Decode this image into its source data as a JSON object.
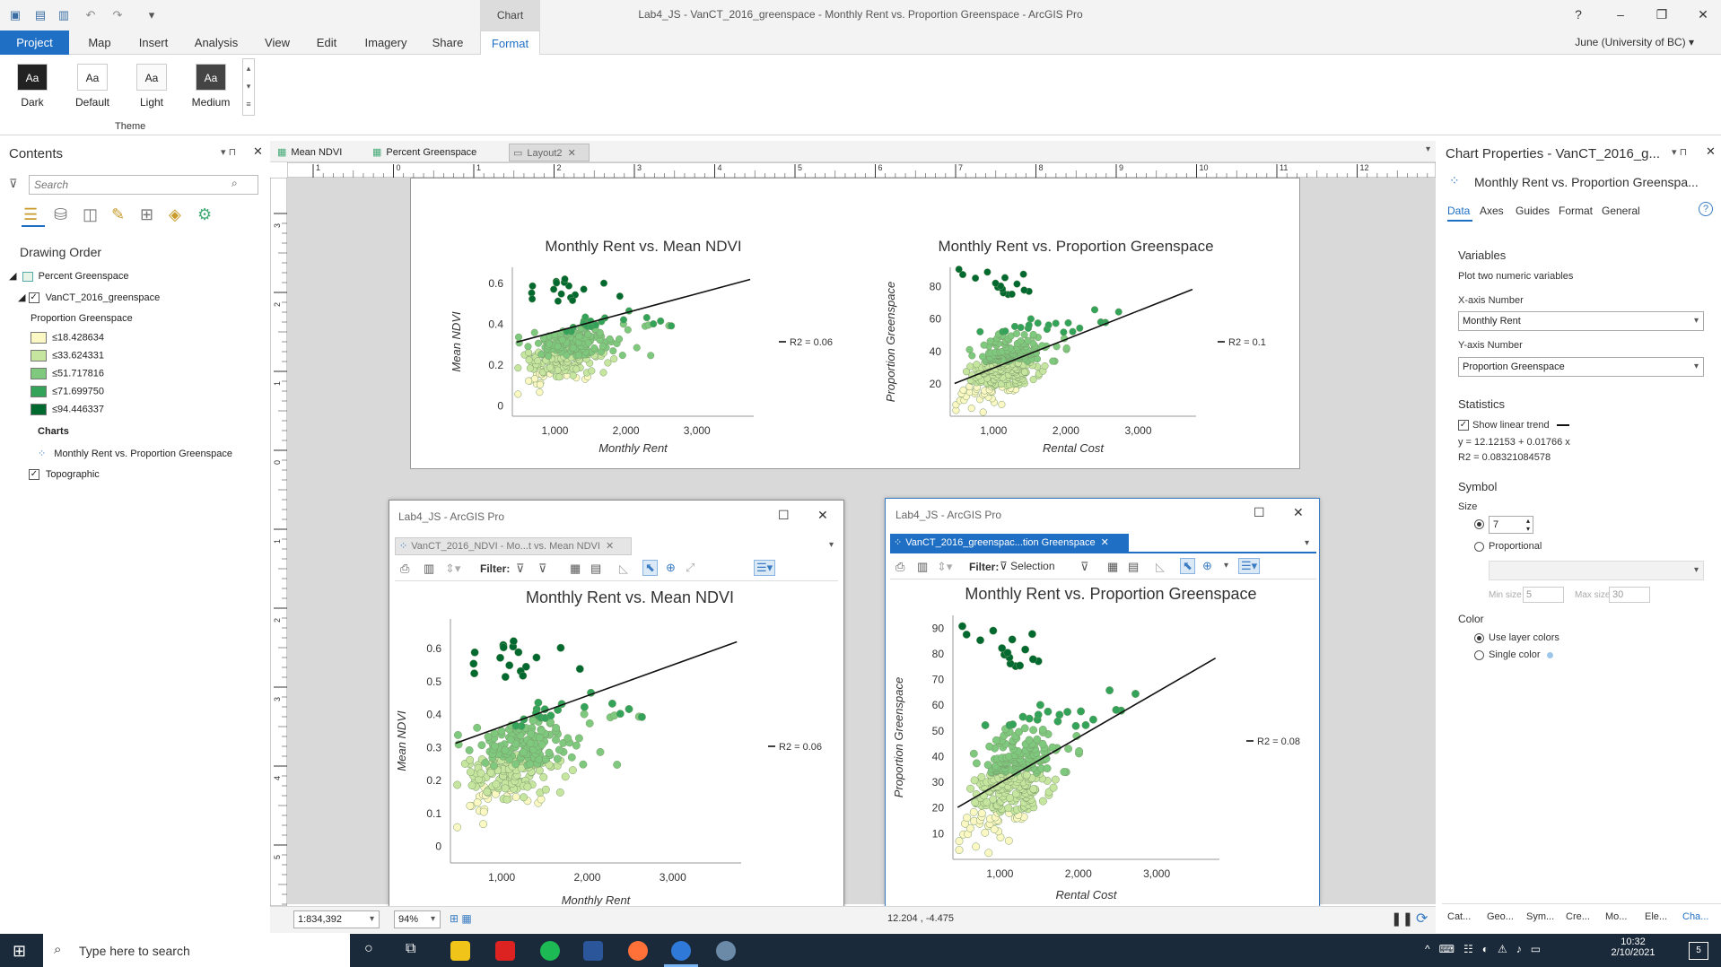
{
  "window": {
    "title": "Lab4_JS - VanCT_2016_greenspace - Monthly Rent vs. Proportion Greenspace - ArcGIS Pro",
    "context_tab": "Chart",
    "help": "?"
  },
  "ribbon": {
    "tabs": [
      "Project",
      "Map",
      "Insert",
      "Analysis",
      "View",
      "Edit",
      "Imagery",
      "Share",
      "Format"
    ],
    "active_tab": "Format",
    "user": "June (University of BC) ▾",
    "theme_group": "Theme",
    "themes": [
      {
        "label": "Dark",
        "glyph": "Aa"
      },
      {
        "label": "Default",
        "glyph": "Aa"
      },
      {
        "label": "Light",
        "glyph": "Aa"
      },
      {
        "label": "Medium",
        "glyph": "Aa"
      }
    ]
  },
  "contents": {
    "title": "Contents",
    "search_placeholder": "Search",
    "drawing_order": "Drawing Order",
    "layers": [
      {
        "name": "Percent Greenspace"
      },
      {
        "name": "VanCT_2016_greenspace",
        "checked": true
      },
      {
        "name": "Topographic",
        "checked": true
      }
    ],
    "legend_title": "Proportion Greenspace",
    "legend": [
      {
        "label": "≤18.428634",
        "color": "#fbf8c4"
      },
      {
        "label": "≤33.624331",
        "color": "#c6e6a0"
      },
      {
        "label": "≤51.717816",
        "color": "#7fc97f"
      },
      {
        "label": "≤71.699750",
        "color": "#33a35a"
      },
      {
        "label": "≤94.446337",
        "color": "#00692f"
      }
    ],
    "charts_label": "Charts",
    "chart_item": "Monthly Rent vs. Proportion Greenspace"
  },
  "view_tabs": [
    {
      "label": "Mean NDVI",
      "active": false
    },
    {
      "label": "Percent Greenspace",
      "active": false
    },
    {
      "label": "Layout2",
      "active": true
    }
  ],
  "ruler_labels": [
    "1",
    "0",
    "1",
    "2",
    "3",
    "4",
    "5",
    "6",
    "7",
    "8",
    "9",
    "10",
    "11",
    "12"
  ],
  "left_ruler_labels": [
    "3",
    "2",
    "1",
    "0",
    "1",
    "2",
    "3",
    "4",
    "5"
  ],
  "windows": [
    {
      "title": "Lab4_JS - ArcGIS Pro",
      "tab": "VanCT_2016_NDVI - Mo...t vs. Mean NDVI",
      "filter": "Filter:"
    },
    {
      "title": "Lab4_JS - ArcGIS Pro",
      "tab": "VanCT_2016_greenspac...tion Greenspace",
      "filter": "Filter:",
      "selection": "Selection"
    }
  ],
  "chart_data": [
    {
      "type": "scatter",
      "title": "Monthly Rent vs. Mean NDVI",
      "xlabel": "Monthly Rent",
      "ylabel": "Mean NDVI",
      "xlim": [
        400,
        3800
      ],
      "ylim": [
        -0.05,
        0.68
      ],
      "xticks": [
        "1,000",
        "2,000",
        "3,000"
      ],
      "xtick_values": [
        1000,
        2000,
        3000
      ],
      "yticks": [
        "0",
        "0.2",
        "0.4",
        "0.6"
      ],
      "ytick_values": [
        0,
        0.2,
        0.4,
        0.6
      ],
      "legend": "R2 = 0.06",
      "trend": {
        "intercept": 0.27,
        "slope": 9.35e-05
      },
      "seed": 3,
      "ymode": "ndvi"
    },
    {
      "type": "scatter",
      "title": "Monthly Rent vs. Proportion Greenspace",
      "xlabel": "Rental Cost",
      "ylabel": "Proportion Greenspace",
      "xlim": [
        400,
        3800
      ],
      "ylim": [
        0,
        92
      ],
      "xticks": [
        "1,000",
        "2,000",
        "3,000"
      ],
      "xtick_values": [
        1000,
        2000,
        3000
      ],
      "yticks": [
        "20",
        "40",
        "60",
        "80"
      ],
      "ytick_values": [
        20,
        40,
        60,
        80
      ],
      "legend": "R2 = 0.1",
      "trend": {
        "intercept": 12.12,
        "slope": 0.01766
      },
      "seed": 7,
      "ymode": "green"
    },
    {
      "type": "scatter",
      "title": "Monthly Rent vs. Mean NDVI",
      "xlabel": "Monthly Rent",
      "ylabel": "Mean NDVI",
      "xlim": [
        400,
        3800
      ],
      "ylim": [
        -0.05,
        0.69
      ],
      "xticks": [
        "1,000",
        "2,000",
        "3,000"
      ],
      "xtick_values": [
        1000,
        2000,
        3000
      ],
      "yticks": [
        "0",
        "0.1",
        "0.2",
        "0.3",
        "0.4",
        "0.5",
        "0.6"
      ],
      "ytick_values": [
        0,
        0.1,
        0.2,
        0.3,
        0.4,
        0.5,
        0.6
      ],
      "legend": "R2 = 0.06",
      "trend": {
        "intercept": 0.27,
        "slope": 9.35e-05
      },
      "seed": 3,
      "ymode": "ndvi"
    },
    {
      "type": "scatter",
      "title": "Monthly Rent vs. Proportion Greenspace",
      "xlabel": "Rental Cost",
      "ylabel": "Proportion Greenspace",
      "xlim": [
        400,
        3800
      ],
      "ylim": [
        0,
        95
      ],
      "xticks": [
        "1,000",
        "2,000",
        "3,000"
      ],
      "xtick_values": [
        1000,
        2000,
        3000
      ],
      "yticks": [
        "10",
        "20",
        "30",
        "40",
        "50",
        "60",
        "70",
        "80",
        "90"
      ],
      "ytick_values": [
        10,
        20,
        30,
        40,
        50,
        60,
        70,
        80,
        90
      ],
      "legend": "R2 = 0.08",
      "trend": {
        "intercept": 12.12,
        "slope": 0.01766
      },
      "seed": 7,
      "ymode": "green"
    }
  ],
  "chart_properties": {
    "title": "Chart Properties - VanCT_2016_g...",
    "chart_name": "Monthly Rent vs. Proportion Greenspa...",
    "tabs": [
      "Data",
      "Axes",
      "Guides",
      "Format",
      "General"
    ],
    "variables_header": "Variables",
    "variables_desc": "Plot two numeric variables",
    "x_label": "X-axis Number",
    "x_value": "Monthly Rent",
    "y_label": "Y-axis Number",
    "y_value": "Proportion Greenspace",
    "statistics_header": "Statistics",
    "show_trend": "Show linear trend",
    "equation": "y = 12.12153 + 0.01766 x",
    "r2": "R2 = 0.08321084578",
    "symbol_header": "Symbol",
    "size_label": "Size",
    "size_value": "7",
    "proportional": "Proportional",
    "min_size_label": "Min size",
    "min_size": "5",
    "max_size_label": "Max size",
    "max_size": "30",
    "color_header": "Color",
    "use_layer_colors": "Use layer colors",
    "single_color": "Single color",
    "bottom_tabs": [
      "Cat...",
      "Geo...",
      "Sym...",
      "Cre...",
      "Mo...",
      "Ele...",
      "Cha..."
    ]
  },
  "status": {
    "scale": "1:834,392",
    "zoom": "94%",
    "coords": "12.204 , -4.475"
  },
  "taskbar": {
    "search": "Type here to search",
    "time": "10:32",
    "date": "2/10/2021",
    "notif": "5"
  }
}
